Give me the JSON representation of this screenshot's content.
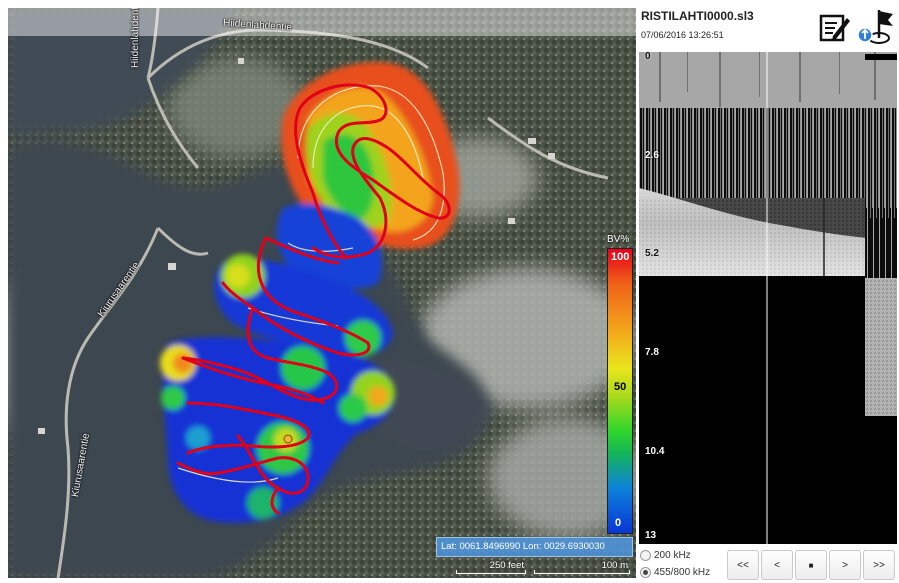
{
  "map": {
    "road_labels": [
      "Hiidenlahdentie",
      "Hiidenlahdentie",
      "Kiurusaarentie",
      "Kiurusaarentie"
    ],
    "colorbar": {
      "title": "BV%",
      "max": "100",
      "mid": "50",
      "min": "0"
    },
    "coordinates": {
      "text": "Lat: 0061.8496990 Lon: 0029.6930030"
    },
    "scale": {
      "feet": "250 feet",
      "meters": "100 m"
    }
  },
  "sonar": {
    "file_name": "RISTILAHTI0000.sl3",
    "timestamp": "07/06/2016 13:26:51",
    "depth_labels": [
      "0",
      "2.6",
      "5.2",
      "7.8",
      "10.4",
      "13"
    ],
    "frequencies": [
      {
        "label": "200 kHz",
        "selected": false
      },
      {
        "label": "455/800 kHz",
        "selected": true
      }
    ],
    "controls": {
      "first": "<<",
      "prev": "<",
      "stop": "■",
      "next": ">",
      "last": ">>"
    }
  },
  "icons": [
    "edit-icon",
    "waypoint-flag-icon"
  ],
  "colors": {
    "track": "#e0001a",
    "panel_bg": "#ffffff",
    "readout_bg": "#4f93d8"
  }
}
